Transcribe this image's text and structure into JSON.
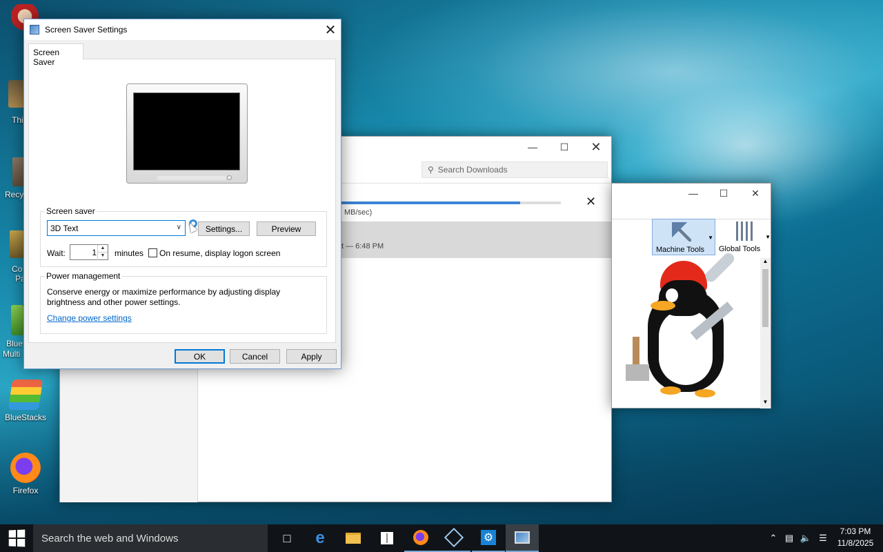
{
  "desktop": {
    "icons": [
      {
        "label": "BlueStacks"
      },
      {
        "label": "Firefox"
      }
    ],
    "partial_labels": [
      "Thi",
      "Recy",
      "Co",
      "Pa",
      "Blue",
      "Multi"
    ]
  },
  "downloads_window": {
    "search_placeholder": "Search Downloads",
    "speed_text": "MB/sec)",
    "time_text": "t — 6:48 PM",
    "progress": 0.82
  },
  "tools_window": {
    "machine_tools": "Machine Tools",
    "global_tools": "Global Tools"
  },
  "dialog": {
    "title": "Screen Saver Settings",
    "tab": "Screen Saver",
    "screen_saver_group": "Screen saver",
    "selected_saver": "3D Text",
    "settings_button": "Settings...",
    "preview_button": "Preview",
    "wait_label": "Wait:",
    "wait_value": "1",
    "minutes_label": "minutes",
    "resume_label": "On resume, display logon screen",
    "power_group": "Power management",
    "power_text": "Conserve energy or maximize performance by adjusting display brightness and other power settings.",
    "power_link": "Change power settings",
    "ok": "OK",
    "cancel": "Cancel",
    "apply": "Apply"
  },
  "taskbar": {
    "search_text": "Search the web and Windows",
    "time": "7:03 PM",
    "date": "11/8/2025"
  }
}
